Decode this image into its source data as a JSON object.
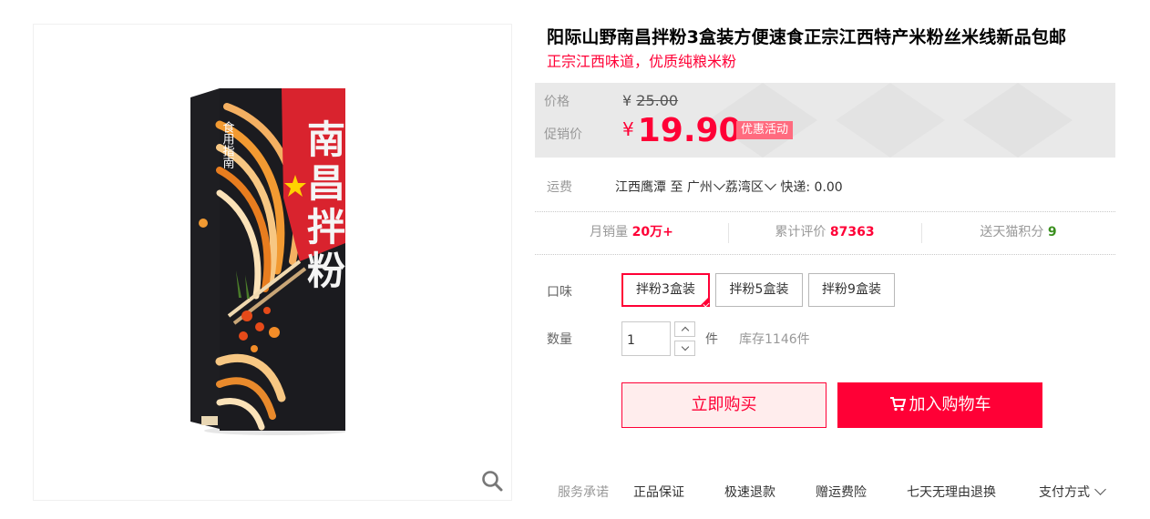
{
  "product": {
    "title": "阳际山野南昌拌粉3盒装方便速食正宗江西特产米粉丝米线新品包邮",
    "subtitle": "正宗江西味道，优质纯粮米粉"
  },
  "box_art": {
    "brand": "食用指南",
    "name": "南昌拌粉"
  },
  "price": {
    "label": "价格",
    "currency": "¥",
    "original": "25.00",
    "promo_label": "促销价",
    "promo_currency": "¥",
    "promo": "19.90",
    "promo_tag": "优惠活动"
  },
  "freight": {
    "label": "运费",
    "origin": "江西鹰潭",
    "to": "至",
    "city": "广州",
    "district": "荔湾区",
    "express": "快递: 0.00"
  },
  "stats": {
    "monthly_sales_label": "月销量",
    "monthly_sales_value": "20万+",
    "reviews_label": "累计评价",
    "reviews_value": "87363",
    "points_label": "送天猫积分",
    "points_value": "9"
  },
  "flavor": {
    "label": "口味",
    "options": [
      "拌粉3盒装",
      "拌粉5盒装",
      "拌粉9盒装"
    ],
    "selected": "拌粉3盒装"
  },
  "quantity": {
    "label": "数量",
    "value": "1",
    "unit": "件",
    "stock": "库存1146件"
  },
  "actions": {
    "buy_now": "立即购买",
    "add_to_cart": "加入购物车"
  },
  "services": {
    "label": "服务承诺",
    "items": [
      "正品保证",
      "极速退款",
      "赠运费险",
      "七天无理由退换"
    ],
    "payment": "支付方式"
  },
  "colors": {
    "accent": "#ff0036",
    "price_bg": "#e9e9e9",
    "promo_tag": "#ff6b7f",
    "green": "#3a8f1e"
  }
}
